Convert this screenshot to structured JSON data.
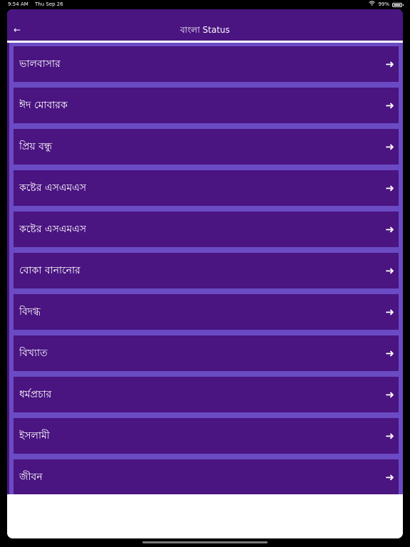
{
  "status_bar": {
    "time": "9:54 AM",
    "date": "Thu Sep 26",
    "battery": "99%",
    "wifi_icon": "wifi-icon",
    "battery_icon": "battery-icon"
  },
  "header": {
    "title": "বাংলা Status",
    "back_icon": "←"
  },
  "colors": {
    "header_bg": "#4a1481",
    "item_bg": "#4a1481",
    "list_bg": "#6a4bc4",
    "text": "#ffffff"
  },
  "list": {
    "items": [
      {
        "label": "ভালবাসার",
        "arrow": "➜"
      },
      {
        "label": "ঈদ মোবারক",
        "arrow": "➜"
      },
      {
        "label": "প্রিয় বন্ধু",
        "arrow": "➜"
      },
      {
        "label": "কষ্টের এসএমএস",
        "arrow": "➜"
      },
      {
        "label": "কষ্টের এসএমএস",
        "arrow": "➜"
      },
      {
        "label": "বোকা বানানোর",
        "arrow": "➜"
      },
      {
        "label": "বিদগ্ধ",
        "arrow": "➜"
      },
      {
        "label": "বিখ্যাত",
        "arrow": "➜"
      },
      {
        "label": "ধর্মপ্রচার",
        "arrow": "➜"
      },
      {
        "label": "ইসলামী",
        "arrow": "➜"
      },
      {
        "label": "জীবন",
        "arrow": "➜"
      }
    ]
  }
}
